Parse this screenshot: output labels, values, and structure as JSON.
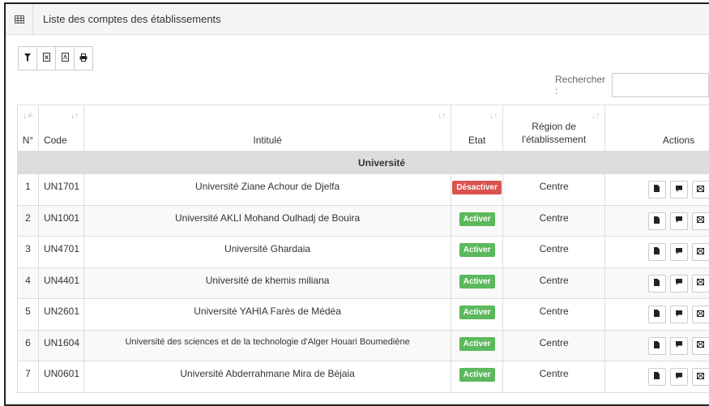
{
  "panel": {
    "title": "Liste des comptes des établissements",
    "icon": "table-grid-icon"
  },
  "toolbar": {
    "icons": [
      "filter-icon",
      "excel-icon",
      "pdf-icon",
      "print-icon"
    ]
  },
  "search": {
    "label": "Rechercher :",
    "value": ""
  },
  "columns": {
    "num": "N°",
    "code": "Code",
    "title": "Intitulé",
    "etat": "Etat",
    "region": "Région de l'établissement",
    "actions": "Actions"
  },
  "group": {
    "label": "Université"
  },
  "rows": [
    {
      "num": "1",
      "code": "UN1701",
      "title": "Université Ziane Achour de Djelfa",
      "etat": "Désactiver",
      "region": "Centre"
    },
    {
      "num": "2",
      "code": "UN1001",
      "title": "Université AKLI Mohand Oulhadj de Bouira",
      "etat": "Activer",
      "region": "Centre"
    },
    {
      "num": "3",
      "code": "UN4701",
      "title": "Université Ghardaia",
      "etat": "Activer",
      "region": "Centre"
    },
    {
      "num": "4",
      "code": "UN4401",
      "title": "Université de khemis miliana",
      "etat": "Activer",
      "region": "Centre"
    },
    {
      "num": "5",
      "code": "UN2601",
      "title": "Université YAHIA Farès de Médéa",
      "etat": "Activer",
      "region": "Centre"
    },
    {
      "num": "6",
      "code": "UN1604",
      "title": "Université des sciences et de la technologie d'Alger Houari Boumediène",
      "etat": "Activer",
      "region": "Centre"
    },
    {
      "num": "7",
      "code": "UN0601",
      "title": "Université Abderrahmane Mira de Béjaia",
      "etat": "Activer",
      "region": "Centre"
    }
  ],
  "colors": {
    "active": "#5cb85c",
    "inactive": "#d9534f",
    "group_bg": "#dddddd"
  }
}
